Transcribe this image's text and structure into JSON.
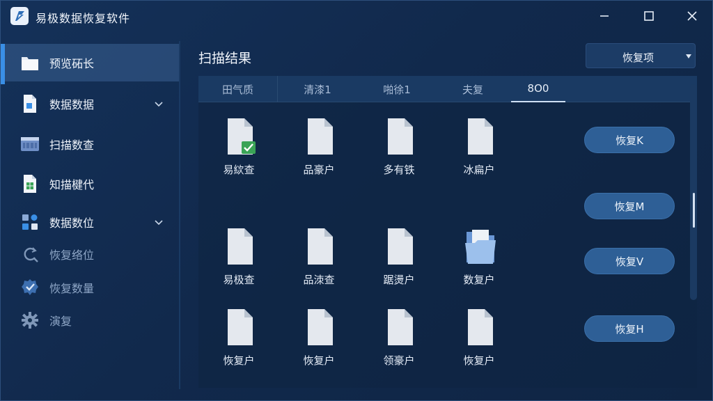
{
  "app": {
    "title": "易极数据恢复软件"
  },
  "sidebar": {
    "items": [
      {
        "label": "预览砳长",
        "icon": "folder-icon",
        "active": true,
        "dim": false,
        "expandable": false
      },
      {
        "label": "数据数据",
        "icon": "document-icon",
        "active": false,
        "dim": false,
        "expandable": true
      },
      {
        "label": "扫描数查",
        "icon": "drive-icon",
        "active": false,
        "dim": false,
        "expandable": false
      },
      {
        "label": "知描楗代",
        "icon": "sheet-icon",
        "active": false,
        "dim": false,
        "expandable": false
      },
      {
        "label": "数据数位",
        "icon": "apps-icon",
        "active": false,
        "dim": false,
        "expandable": true
      },
      {
        "label": "恢复络位",
        "icon": "refresh-search-icon",
        "active": false,
        "dim": true,
        "expandable": false
      },
      {
        "label": "恢复数量",
        "icon": "check-badge-icon",
        "active": false,
        "dim": true,
        "expandable": false
      },
      {
        "label": "演复",
        "icon": "gear-icon",
        "active": false,
        "dim": true,
        "expandable": false
      }
    ]
  },
  "main": {
    "title": "扫描结果",
    "restore_select": {
      "value": "恢复项"
    },
    "tabs": [
      {
        "label": "田气质",
        "active": false
      },
      {
        "label": "清漆1",
        "active": false
      },
      {
        "label": "啪徐1",
        "active": false
      },
      {
        "label": "夫复",
        "active": false
      },
      {
        "label": "8O0",
        "active": true
      }
    ],
    "files": [
      {
        "name": "易絘查",
        "icon": "file-checked-icon"
      },
      {
        "name": "品豪户",
        "icon": "file-icon"
      },
      {
        "name": "多有铁",
        "icon": "file-icon"
      },
      {
        "name": "冰扁户",
        "icon": "file-icon"
      },
      {
        "name": "易极查",
        "icon": "file-icon"
      },
      {
        "name": "品洓查",
        "icon": "file-icon"
      },
      {
        "name": "踞燙户",
        "icon": "file-icon"
      },
      {
        "name": "数复户",
        "icon": "folder-open-icon"
      },
      {
        "name": "恢复户",
        "icon": "file-icon"
      },
      {
        "name": "恢复户",
        "icon": "file-icon"
      },
      {
        "name": "领豪户",
        "icon": "file-icon"
      },
      {
        "name": "恢复户",
        "icon": "file-icon"
      }
    ],
    "restore_buttons": [
      {
        "label": "恢复K"
      },
      {
        "label": "恢复M"
      },
      {
        "label": "恢复V"
      },
      {
        "label": "恢复H"
      }
    ]
  },
  "colors": {
    "accent": "#3a8fe6",
    "button": "#2e5f96",
    "background": "#11294c"
  }
}
